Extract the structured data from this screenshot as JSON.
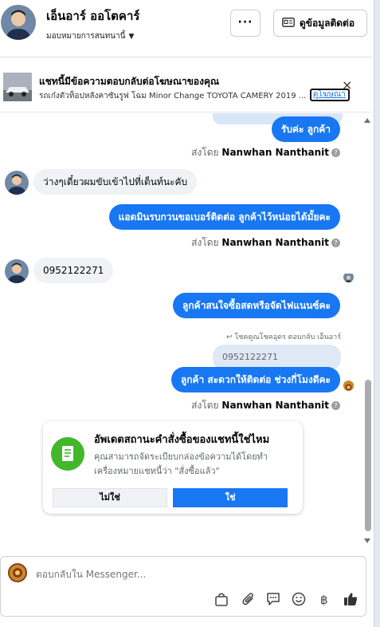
{
  "header": {
    "contact_name": "เอ็นอาร์ ออโตคาร์",
    "assign_label": "มอบหมายการสนทนานี้",
    "more_label": "···",
    "view_contact_label": "ดูข้อมูลติดต่อ"
  },
  "ad_banner": {
    "title": "แชทนี้มีข้อความตอบกลับต่อโฆษณาของคุณ",
    "subtitle": "รถเก๋งตัวท็อปหลังคาซันรูฟ โฉม Minor Change TOYOTA CAMERY 2019 ...",
    "link_label": "ดูโฆษณา",
    "close_icon": "×"
  },
  "messages": {
    "m1_out": "รับค่ะ ลูกค้า",
    "sent_prefix": "ส่งโดย",
    "agent_name": "Nanwhan Nanthanit",
    "m2_in": "ว่างๆเดี๋ยวผมขับเข้าไปที่เต็นท์นะคับ",
    "m3_out": "แอดมินรบกวนขอเบอร์ติดต่อ ลูกค้าไว้หน่อยได้มั้ยคะ",
    "m4_in": "0952122271",
    "m5_out": "ลูกค้าสนใจซื้อสดหรือจัดไฟแนนซ์คะ",
    "reply_meta": "↩ โชคคูณโชคอุดร ตอบกลับ เอ็นอาร์",
    "reply_quote": "0952122271",
    "m6_out": "ลูกค้า สะดวกให้ติดต่อ ช่วงกี่โมงดีคะ"
  },
  "status_card": {
    "title": "อัพเดตสถานะคำสั่งซื้อของแชทนี้ใช่ไหม",
    "text": "คุณสามารถจัดระเบียบกล่องข้อความได้โดยทำเครื่องหมายแชทนี้ว่า \"สั่งซื้อแล้ว\"",
    "no_label": "ไม่ใช่",
    "yes_label": "ใช่"
  },
  "composer": {
    "placeholder": "ตอบกลับใน Messenger...",
    "tools": [
      "bag-icon",
      "paperclip-icon",
      "speech-bubble-icon",
      "smiley-icon",
      "baht-icon",
      "thumbs-up-icon"
    ]
  },
  "colors": {
    "accent": "#1877f2",
    "incoming_bubble": "#f0f2f5",
    "status_icon": "#42b72a"
  }
}
